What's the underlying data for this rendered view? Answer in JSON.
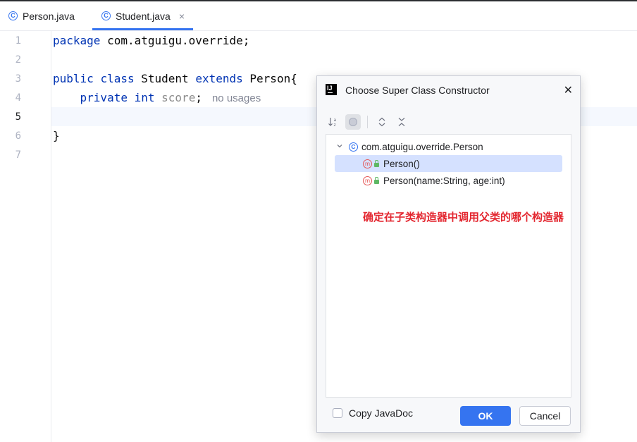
{
  "tabs": [
    {
      "label": "Person.java",
      "icon": "class-icon",
      "active": false
    },
    {
      "label": "Student.java",
      "icon": "class-icon",
      "active": true,
      "close": "×"
    }
  ],
  "editor": {
    "line_numbers": [
      "1",
      "2",
      "3",
      "4",
      "5",
      "6",
      "7"
    ],
    "current_line": "5",
    "lines": {
      "l1_kw": "package",
      "l1_rest": " com.atguigu.override;",
      "l3_kw1": "public",
      "l3_kw2": "class",
      "l3_name": "Student",
      "l3_kw3": "extends",
      "l3_super": "Person{",
      "l4_kw1": "private",
      "l4_kw2": "int",
      "l4_field": "score",
      "l4_semi": ";",
      "l4_hint": "no usages",
      "l6": "}"
    }
  },
  "dialog": {
    "title": "Choose Super Class Constructor",
    "close": "✕",
    "toolbar": {
      "sort_icon": "sort-alpha-icon",
      "filter_icon": "show-inherited-icon",
      "expand_icon": "expand-all-icon",
      "collapse_icon": "collapse-all-icon"
    },
    "tree": {
      "root_label": "com.atguigu.override.Person",
      "items": [
        {
          "label": "Person()",
          "selected": true
        },
        {
          "label": "Person(name:String, age:int)",
          "selected": false
        }
      ]
    },
    "annotation": "确定在子类构造器中调用父类的哪个构造器",
    "copy_javadoc_label": "Copy JavaDoc",
    "copy_javadoc_checked": false,
    "ok_label": "OK",
    "cancel_label": "Cancel"
  },
  "colors": {
    "accent": "#3574f0",
    "keyword": "#0033b3",
    "field": "#871094",
    "annotation_red": "#e3262f",
    "selection": "#d5e1ff"
  }
}
